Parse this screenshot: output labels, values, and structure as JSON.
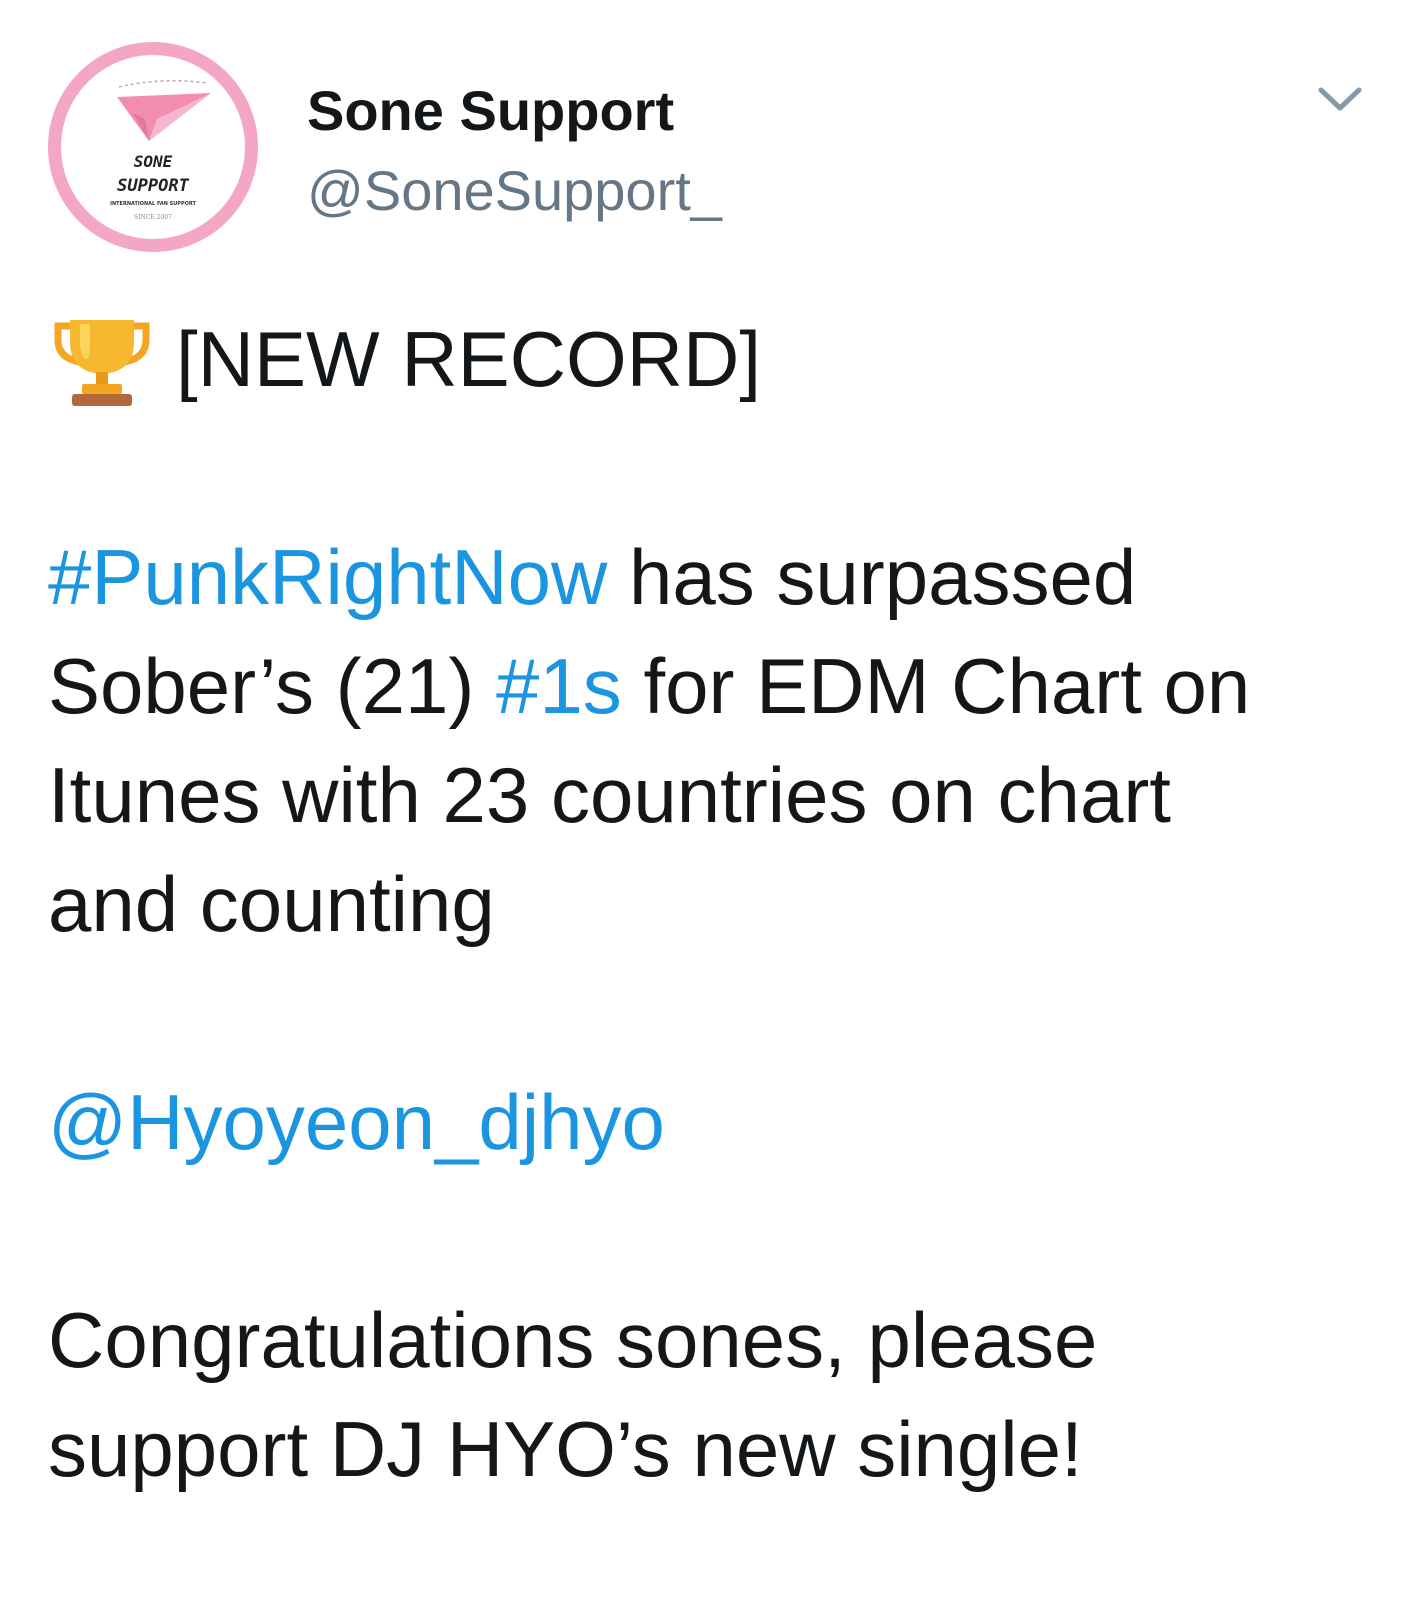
{
  "user": {
    "display_name": "Sone Support",
    "handle": "@SoneSupport_",
    "avatar": {
      "line1": "SONE",
      "line2": "SUPPORT",
      "line3": "INTERNATIONAL FAN SUPPORT",
      "line4": "SINCE 2007",
      "ring_color": "#f4a7c5",
      "plane_color": "#f28cb1"
    }
  },
  "menu": {
    "icon": "chevron-down-icon"
  },
  "tweet": {
    "emoji": "trophy-icon",
    "record_label": "[NEW RECORD]",
    "p1": {
      "hashtag1": "#PunkRightNow",
      "t1": " has surpassed",
      "t2": "Sober’s (21) ",
      "hashtag2": "#1s",
      "t3": " for EDM Chart on",
      "t4": "Itunes with 23 countries on chart",
      "t5": "and counting"
    },
    "mention": "@Hyoyeon_djhyo",
    "p3": {
      "line1": "Congratulations sones, please",
      "line2": "support DJ HYO’s new single!"
    }
  },
  "colors": {
    "link": "#1b95e0",
    "text": "#14171a",
    "secondary": "#657786"
  }
}
